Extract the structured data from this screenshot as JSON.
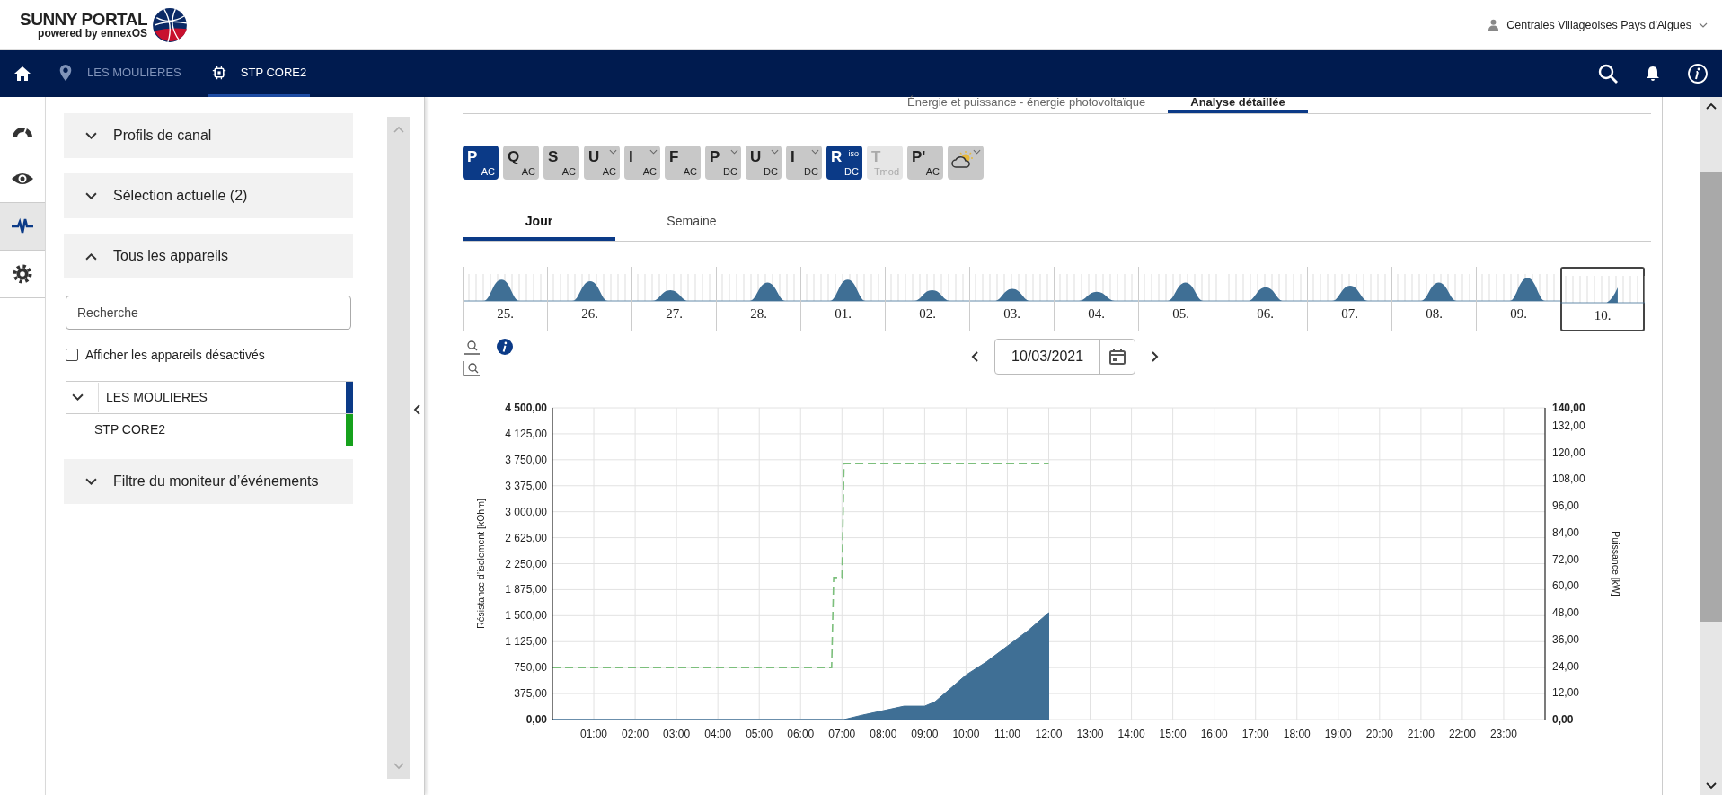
{
  "header": {
    "logo_title": "SUNNY PORTAL",
    "logo_subtitle": "powered by ennexOS",
    "user": "Centrales Villageoises Pays d'Aigues"
  },
  "nav": {
    "breadcrumbs": [
      {
        "label": "LES MOULIERES",
        "kind": "site",
        "selected": false
      },
      {
        "label": "STP CORE2",
        "kind": "device",
        "selected": true
      }
    ]
  },
  "rail": [
    {
      "kind": "gauge",
      "selected": false
    },
    {
      "kind": "eye",
      "selected": false
    },
    {
      "kind": "pulse",
      "selected": true
    },
    {
      "kind": "gear",
      "selected": false
    }
  ],
  "sidebar": {
    "sections": [
      {
        "title": "Profils de canal",
        "expanded": false
      },
      {
        "title": "Sélection actuelle (2)",
        "expanded": false
      },
      {
        "title": "Tous les appareils",
        "expanded": true,
        "search": {
          "placeholder": "Recherche"
        },
        "checkbox": {
          "label": "Afficher les appareils désactivés",
          "checked": false
        },
        "tree": [
          {
            "label": "LES MOULIERES",
            "color": "#0b3a87",
            "expanded": true,
            "children": [
              {
                "label": "STP CORE2",
                "color": "#16a11c"
              }
            ]
          }
        ]
      },
      {
        "title": "Filtre du moniteur d’événements",
        "expanded": false
      }
    ]
  },
  "main": {
    "view_tabs": [
      {
        "label": "Énergie et puissance - énergie photovoltaïque",
        "selected": false
      },
      {
        "label": "Analyse détaillée",
        "selected": true
      }
    ],
    "channels": [
      {
        "kind": "text",
        "main": "P",
        "sub": "AC",
        "selected": true,
        "disabled": false,
        "dropdown": false
      },
      {
        "kind": "text",
        "main": "Q",
        "sub": "AC",
        "selected": false,
        "disabled": false,
        "dropdown": false
      },
      {
        "kind": "text",
        "main": "S",
        "sub": "AC",
        "selected": false,
        "disabled": false,
        "dropdown": false
      },
      {
        "kind": "text",
        "main": "U",
        "sub": "AC",
        "selected": false,
        "disabled": false,
        "dropdown": true
      },
      {
        "kind": "text",
        "main": "I",
        "sub": "AC",
        "selected": false,
        "disabled": false,
        "dropdown": true
      },
      {
        "kind": "text",
        "main": "F",
        "sub": "AC",
        "selected": false,
        "disabled": false,
        "dropdown": false
      },
      {
        "kind": "text",
        "main": "P",
        "sub": "DC",
        "selected": false,
        "disabled": false,
        "dropdown": true
      },
      {
        "kind": "text",
        "main": "U",
        "sub": "DC",
        "selected": false,
        "disabled": false,
        "dropdown": true
      },
      {
        "kind": "text",
        "main": "I",
        "sub": "DC",
        "selected": false,
        "disabled": false,
        "dropdown": true
      },
      {
        "kind": "text",
        "main": "R",
        "sup": "iso",
        "sub": "DC",
        "selected": true,
        "disabled": false,
        "dropdown": false
      },
      {
        "kind": "text",
        "main": "T",
        "sub": "Tmod",
        "selected": false,
        "disabled": true,
        "dropdown": false
      },
      {
        "kind": "text",
        "main": "P'",
        "sub": "AC",
        "selected": false,
        "disabled": false,
        "dropdown": false
      },
      {
        "kind": "weather",
        "selected": false,
        "disabled": false,
        "dropdown": true
      }
    ],
    "period_tabs": [
      {
        "label": "Jour",
        "selected": true
      },
      {
        "label": "Semaine",
        "selected": false
      }
    ],
    "overview": {
      "days": [
        {
          "label": "25.",
          "selected": false
        },
        {
          "label": "26.",
          "selected": false
        },
        {
          "label": "27.",
          "selected": false
        },
        {
          "label": "28.",
          "selected": false
        },
        {
          "label": "01.",
          "selected": false
        },
        {
          "label": "02.",
          "selected": false
        },
        {
          "label": "03.",
          "selected": false
        },
        {
          "label": "04.",
          "selected": false
        },
        {
          "label": "05.",
          "selected": false
        },
        {
          "label": "06.",
          "selected": false
        },
        {
          "label": "07.",
          "selected": false
        },
        {
          "label": "08.",
          "selected": false
        },
        {
          "label": "09.",
          "selected": false
        },
        {
          "label": "10.",
          "selected": true
        }
      ]
    },
    "date": {
      "value": "10/03/2021"
    },
    "chart_data": {
      "type": "line",
      "grid": true,
      "ylabel": "Résistance d’isolement [kOhm]",
      "y2label": "Puissance [kW]",
      "x": [
        0,
        1,
        2,
        3,
        4,
        5,
        6,
        6.75,
        6.8,
        7.0,
        7.05,
        7.5,
        8,
        8.5,
        9,
        9.25,
        9.5,
        10,
        10.5,
        11,
        11.5,
        12
      ],
      "series": [
        {
          "color": "#7cbf7c",
          "line_style": "dashed",
          "values": [
            750,
            750,
            750,
            750,
            750,
            750,
            750,
            750,
            2050,
            2050,
            3700,
            3700,
            3700,
            3700,
            3700,
            3700,
            3700,
            3700,
            3700,
            3700,
            3700,
            3700
          ]
        },
        {
          "color": "#3f6f95",
          "axis": "y2",
          "type": "area",
          "values": [
            0,
            0,
            0,
            0,
            0,
            0,
            0,
            0,
            0,
            0,
            0,
            2,
            4,
            6,
            6,
            8,
            12,
            20,
            26,
            33,
            40,
            48
          ]
        }
      ],
      "xlim": [
        0,
        24
      ],
      "ylim": [
        0,
        4500
      ],
      "y2lim": [
        0,
        140
      ],
      "xticks": [
        {
          "value": 1,
          "label": "01:00"
        },
        {
          "value": 2,
          "label": "02:00"
        },
        {
          "value": 3,
          "label": "03:00"
        },
        {
          "value": 4,
          "label": "04:00"
        },
        {
          "value": 5,
          "label": "05:00"
        },
        {
          "value": 6,
          "label": "06:00"
        },
        {
          "value": 7,
          "label": "07:00"
        },
        {
          "value": 8,
          "label": "08:00"
        },
        {
          "value": 9,
          "label": "09:00"
        },
        {
          "value": 10,
          "label": "10:00"
        },
        {
          "value": 11,
          "label": "11:00"
        },
        {
          "value": 12,
          "label": "12:00"
        },
        {
          "value": 13,
          "label": "13:00"
        },
        {
          "value": 14,
          "label": "14:00"
        },
        {
          "value": 15,
          "label": "15:00"
        },
        {
          "value": 16,
          "label": "16:00"
        },
        {
          "value": 17,
          "label": "17:00"
        },
        {
          "value": 18,
          "label": "18:00"
        },
        {
          "value": 19,
          "label": "19:00"
        },
        {
          "value": 20,
          "label": "20:00"
        },
        {
          "value": 21,
          "label": "21:00"
        },
        {
          "value": 22,
          "label": "22:00"
        },
        {
          "value": 23,
          "label": "23:00"
        }
      ],
      "yticks": [
        {
          "value": 0,
          "label": "0,00"
        },
        {
          "value": 375,
          "label": "375,00"
        },
        {
          "value": 750,
          "label": "750,00"
        },
        {
          "value": 1125,
          "label": "1 125,00"
        },
        {
          "value": 1500,
          "label": "1 500,00"
        },
        {
          "value": 1875,
          "label": "1 875,00"
        },
        {
          "value": 2250,
          "label": "2 250,00"
        },
        {
          "value": 2625,
          "label": "2 625,00"
        },
        {
          "value": 3000,
          "label": "3 000,00"
        },
        {
          "value": 3375,
          "label": "3 375,00"
        },
        {
          "value": 3750,
          "label": "3 750,00"
        },
        {
          "value": 4125,
          "label": "4 125,00"
        },
        {
          "value": 4500,
          "label": "4 500,00"
        }
      ],
      "y2ticks": [
        {
          "value": 0,
          "label": "0,00"
        },
        {
          "value": 12,
          "label": "12,00"
        },
        {
          "value": 24,
          "label": "24,00"
        },
        {
          "value": 36,
          "label": "36,00"
        },
        {
          "value": 48,
          "label": "48,00"
        },
        {
          "value": 60,
          "label": "60,00"
        },
        {
          "value": 72,
          "label": "72,00"
        },
        {
          "value": 84,
          "label": "84,00"
        },
        {
          "value": 96,
          "label": "96,00"
        },
        {
          "value": 108,
          "label": "108,00"
        },
        {
          "value": 120,
          "label": "120,00"
        },
        {
          "value": 132,
          "label": "132,00"
        },
        {
          "value": 140,
          "label": "140,00"
        }
      ]
    }
  }
}
